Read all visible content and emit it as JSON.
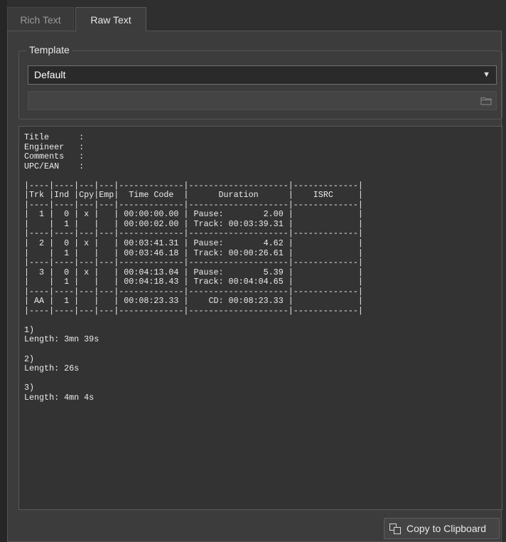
{
  "tabs": [
    {
      "label": "Rich Text",
      "active": false
    },
    {
      "label": "Raw Text",
      "active": true
    }
  ],
  "template": {
    "group_title": "Template",
    "selected": "Default",
    "path_value": ""
  },
  "report_lines": [
    "Title      :",
    "Engineer   :",
    "Comments   :",
    "UPC/EAN    :",
    "",
    "|----|----|---|---|-------------|--------------------|-------------|",
    "|Trk |Ind |Cpy|Emp|  Time Code  |      Duration      |    ISRC     |",
    "|----|----|---|---|-------------|--------------------|-------------|",
    "|  1 |  0 | x |   | 00:00:00.00 | Pause:        2.00 |             |",
    "|    |  1 |   |   | 00:00:02.00 | Track: 00:03:39.31 |             |",
    "|----|----|---|---|-------------|--------------------|-------------|",
    "|  2 |  0 | x |   | 00:03:41.31 | Pause:        4.62 |             |",
    "|    |  1 |   |   | 00:03:46.18 | Track: 00:00:26.61 |             |",
    "|----|----|---|---|-------------|--------------------|-------------|",
    "|  3 |  0 | x |   | 00:04:13.04 | Pause:        5.39 |             |",
    "|    |  1 |   |   | 00:04:18.43 | Track: 00:04:04.65 |             |",
    "|----|----|---|---|-------------|--------------------|-------------|",
    "| AA |  1 |   |   | 00:08:23.33 |    CD: 00:08:23.33 |             |",
    "|----|----|---|---|-------------|--------------------|-------------|",
    "",
    "1)",
    "Length: 3mn 39s",
    "",
    "2)",
    "Length: 26s",
    "",
    "3)",
    "Length: 4mn 4s"
  ],
  "actions": {
    "copy_label": "Copy to Clipboard"
  },
  "icons": {
    "dropdown": "chevron-down-icon",
    "folder": "folder-icon",
    "copy": "copy-icon"
  }
}
